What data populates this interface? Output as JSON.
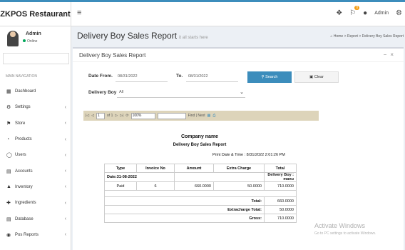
{
  "brand": "ZKPOS Restaurant",
  "header": {
    "notif_count": "0",
    "user_name": "Admin"
  },
  "user": {
    "name": "Admin",
    "status": "Online"
  },
  "sidebar": {
    "header": "MAIN NAVIGATION",
    "items": [
      {
        "label": "Dashboard",
        "icon": "dashboard-icon",
        "has_children": false
      },
      {
        "label": "Settings",
        "icon": "settings-icon",
        "has_children": true
      },
      {
        "label": "Store",
        "icon": "store-icon",
        "has_children": true
      },
      {
        "label": "Products",
        "icon": "products-icon",
        "has_children": true
      },
      {
        "label": "Users",
        "icon": "users-icon",
        "has_children": true
      },
      {
        "label": "Accounts",
        "icon": "accounts-icon",
        "has_children": true
      },
      {
        "label": "Inventory",
        "icon": "inventory-icon",
        "has_children": true
      },
      {
        "label": "Ingredients",
        "icon": "ingredients-icon",
        "has_children": true
      },
      {
        "label": "Database",
        "icon": "database-icon",
        "has_children": true
      },
      {
        "label": "Pos Reports",
        "icon": "reports-icon",
        "has_children": true
      }
    ]
  },
  "page": {
    "title": "Delivery Boy Sales Report",
    "subtitle": "it all starts here",
    "breadcrumb_home": "Home",
    "breadcrumb_1": "Report",
    "breadcrumb_2": "Delivery Boy Sales Report"
  },
  "box": {
    "title": "Delivery Boy Sales Report"
  },
  "filters": {
    "date_from_label": "Date From.",
    "date_from_value": "08/31/2022",
    "to_label": "To.",
    "to_value": "08/31/2022",
    "search_label": "Search",
    "clear_label": "Clear",
    "delivery_boy_label": "Delivery Boy",
    "delivery_boy_value": "All"
  },
  "viewer": {
    "page_value": "1",
    "page_of": "of 1",
    "zoom": "100%",
    "find_next": "Find | Next"
  },
  "report": {
    "company": "Company name",
    "title": "Delivery Boy Sales Report",
    "print_info": "Print Date & Time : 8/31/2022 2:01:26 PM",
    "headers": [
      "Type",
      "Invoice No",
      "Amount",
      "Extra Charge",
      "Total"
    ],
    "date_row": "Date:31-08-2022",
    "delivery_boy": "Delivery Boy : manu",
    "rows": [
      {
        "type": "Paid",
        "invoice": "6",
        "amount": "660.0000",
        "extra": "50.0000",
        "total": "710.0000"
      }
    ],
    "summary": [
      {
        "label": "Total:",
        "value": "660.0000"
      },
      {
        "label": "Extracharge Total:",
        "value": "50.0000"
      },
      {
        "label": "Gross:",
        "value": "710.0000"
      }
    ]
  },
  "watermark": {
    "line1": "Activate Windows",
    "line2": "Go to PC settings to activate Windows."
  },
  "colors": {
    "accent": "#3c8dbc",
    "online": "#00a65a",
    "viewer_toolbar": "#ddd4ba"
  }
}
